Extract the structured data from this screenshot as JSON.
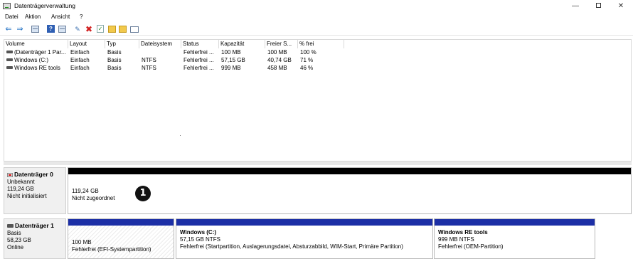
{
  "window": {
    "title": "Datenträgerverwaltung",
    "min_label": "—",
    "close_label": "✕"
  },
  "menu": [
    "Datei",
    "Aktion",
    "Ansicht",
    "?"
  ],
  "toolbar": {
    "back_glyph": "⇐",
    "forward_glyph": "⇒",
    "help_glyph": "?",
    "x_glyph": "✖",
    "check_glyph": "✓",
    "wand_glyph": "✎",
    "icons": [
      "back-icon",
      "forward-icon",
      "list-view-icon",
      "help-icon",
      "grid-icon",
      "connect-icon",
      "delete-icon",
      "check-icon",
      "folder-icon",
      "folder-wand-icon",
      "properties-icon"
    ]
  },
  "table": {
    "columns": [
      "Volume",
      "Layout",
      "Typ",
      "Dateisystem",
      "Status",
      "Kapazität",
      "Freier S...",
      "% frei"
    ],
    "rows": [
      [
        "(Datenträger 1 Par...",
        "Einfach",
        "Basis",
        "",
        "Fehlerfrei ...",
        "100 MB",
        "100 MB",
        "100 %"
      ],
      [
        "Windows (C:)",
        "Einfach",
        "Basis",
        "NTFS",
        "Fehlerfrei ...",
        "57,15 GB",
        "40,74 GB",
        "71 %"
      ],
      [
        "Windows RE tools",
        "Einfach",
        "Basis",
        "NTFS",
        "Fehlerfrei ...",
        "999 MB",
        "458 MB",
        "46 %"
      ]
    ]
  },
  "disk0": {
    "name": "Datenträger 0",
    "type": "Unbekannt",
    "size": "119,24 GB",
    "state": "Nicht initialisiert",
    "partition": {
      "size": "119,24 GB",
      "label": "Nicht zugeordnet"
    }
  },
  "disk1": {
    "name": "Datenträger 1",
    "type": "Basis",
    "size": "58,23 GB",
    "state": "Online",
    "partitions": [
      {
        "title": "",
        "size": "100 MB",
        "status": "Fehlerfrei (EFI-Systempartition)"
      },
      {
        "title": "Windows  (C:)",
        "size": "57,15 GB NTFS",
        "status": "Fehlerfrei (Startpartition, Auslagerungsdatei, Absturzabbild, WIM-Start, Primäre Partition)"
      },
      {
        "title": "Windows RE tools",
        "size": "999 MB NTFS",
        "status": "Fehlerfrei (OEM-Partition)"
      }
    ]
  },
  "callout": "1",
  "colors": {
    "unallocated_bar": "#000000",
    "primary_bar": "#1c2fa6",
    "label_panel": "#f0f0f0",
    "accent_red": "#d10000"
  }
}
